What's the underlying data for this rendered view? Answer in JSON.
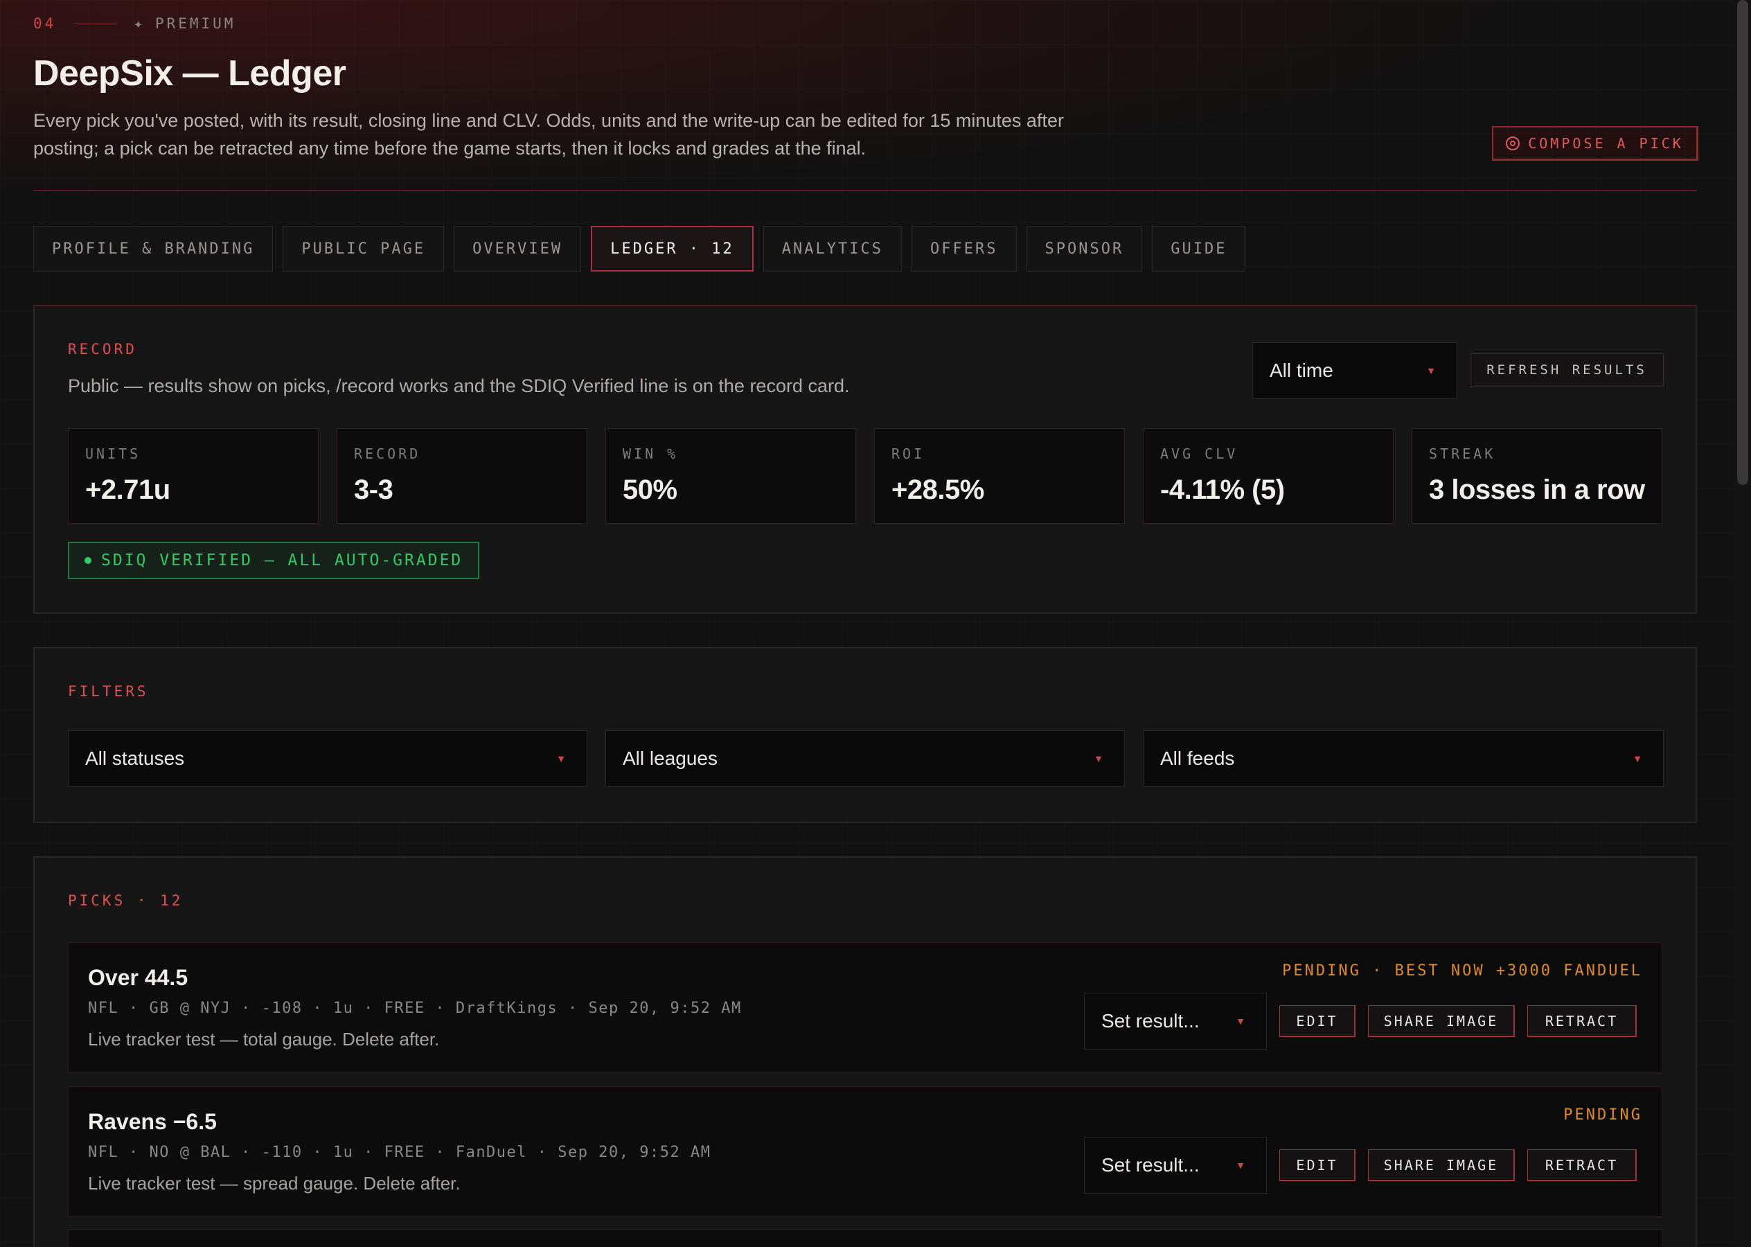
{
  "header": {
    "section_number": "04",
    "star": "✦",
    "tier": "PREMIUM",
    "title": "DeepSix — Ledger",
    "description": "Every pick you've posted, with its result, closing line and CLV. Odds, units and the write-up can be edited for 15 minutes after posting; a pick can be retracted any time before the game starts, then it locks and grades at the final.",
    "compose_label": "COMPOSE A PICK"
  },
  "tabs": [
    {
      "label": "PROFILE & BRANDING"
    },
    {
      "label": "PUBLIC PAGE"
    },
    {
      "label": "OVERVIEW"
    },
    {
      "label": "LEDGER · 12",
      "active": true
    },
    {
      "label": "ANALYTICS"
    },
    {
      "label": "OFFERS"
    },
    {
      "label": "SPONSOR"
    },
    {
      "label": "GUIDE"
    }
  ],
  "record": {
    "label": "RECORD",
    "subtitle": "Public — results show on picks, /record works and the SDIQ Verified line is on the record card.",
    "range_selected": "All time",
    "refresh_label": "REFRESH RESULTS",
    "stats": [
      {
        "label": "UNITS",
        "value": "+2.71u"
      },
      {
        "label": "RECORD",
        "value": "3-3"
      },
      {
        "label": "WIN %",
        "value": "50%"
      },
      {
        "label": "ROI",
        "value": "+28.5%"
      },
      {
        "label": "AVG CLV",
        "value": "-4.11% (5)"
      },
      {
        "label": "STREAK",
        "value": "3 losses in a row"
      }
    ],
    "verified_label": "SDIQ VERIFIED — ALL AUTO-GRADED"
  },
  "filters": {
    "label": "FILTERS",
    "status_selected": "All statuses",
    "league_selected": "All leagues",
    "feed_selected": "All feeds"
  },
  "picks": {
    "label": "PICKS · 12",
    "items": [
      {
        "title": "Over 44.5",
        "meta": "NFL · GB @ NYJ · -108 · 1u · FREE · DraftKings · Sep 20, 9:52 AM",
        "note": "Live tracker test — total gauge. Delete after.",
        "status": "PENDING · BEST NOW +3000 FANDUEL",
        "result_placeholder": "Set result...",
        "edit": "EDIT",
        "share": "SHARE IMAGE",
        "retract": "RETRACT"
      },
      {
        "title": "Ravens −6.5",
        "meta": "NFL · NO @ BAL · -110 · 1u · FREE · FanDuel · Sep 20, 9:52 AM",
        "note": "Live tracker test — spread gauge. Delete after.",
        "status": "PENDING",
        "result_placeholder": "Set result...",
        "edit": "EDIT",
        "share": "SHARE IMAGE",
        "retract": "RETRACT"
      }
    ]
  },
  "colors": {
    "accent": "#e05050",
    "verified": "#2ecc63",
    "pending": "#e0882a",
    "background": "#121111"
  }
}
